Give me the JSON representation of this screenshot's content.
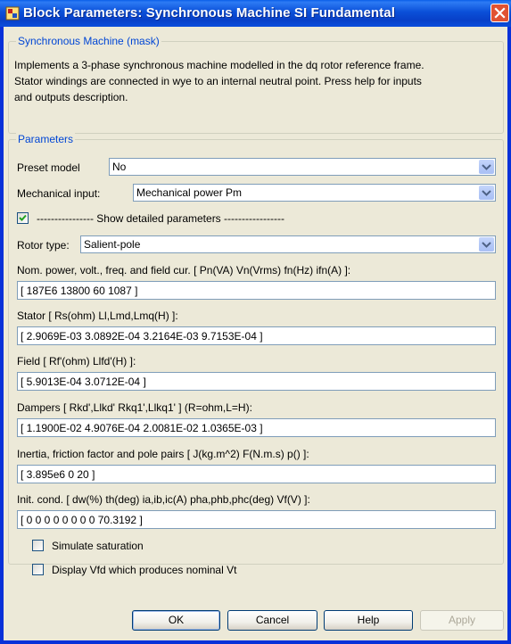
{
  "window": {
    "title": "Block Parameters: Synchronous Machine SI Fundamental",
    "close_label": "X"
  },
  "mask": {
    "group_title": "Synchronous Machine (mask)",
    "description_lines": [
      "Implements a 3-phase synchronous machine modelled in the dq rotor reference frame.",
      "Stator windings are connected in wye to an internal neutral point. Press help for inputs",
      "and outputs description."
    ]
  },
  "params": {
    "group_title": "Parameters",
    "preset_model": {
      "label": "Preset  model",
      "value": "No"
    },
    "mechanical_input": {
      "label": "Mechanical input:",
      "value": "Mechanical power Pm"
    },
    "show_detailed": {
      "label": "---------------- Show detailed parameters -----------------",
      "checked": true
    },
    "rotor_type": {
      "label": "Rotor type:",
      "value": "Salient-pole"
    },
    "fields": [
      {
        "label": "Nom. power, volt., freq. and field cur. [ Pn(VA) Vn(Vrms) fn(Hz) ifn(A) ]:",
        "value": "[ 187E6  13800   60   1087 ]"
      },
      {
        "label": "Stator [ Rs(ohm)  Ll,Lmd,Lmq(H) ]:",
        "value": "[ 2.9069E-03  3.0892E-04  3.2164E-03  9.7153E-04 ]"
      },
      {
        "label": "Field [ Rf'(ohm)  Llfd'(H) ]:",
        "value": "[ 5.9013E-04  3.0712E-04 ]"
      },
      {
        "label": "Dampers [ Rkd',Llkd'  Rkq1',Llkq1'  ] (R=ohm,L=H):",
        "value": "[ 1.1900E-02  4.9076E-04  2.0081E-02  1.0365E-03 ]"
      },
      {
        "label": "Inertia, friction factor and pole pairs [ J(kg.m^2)  F(N.m.s)  p() ]:",
        "value": "[ 3.895e6  0  20 ]"
      },
      {
        "label": "Init. cond. [ dw(%)  th(deg)  ia,ib,ic(A)  pha,phb,phc(deg)  Vf(V) ]:",
        "value": "[ 0  0  0  0  0  0  0  0  70.3192 ]"
      }
    ],
    "simulate_saturation": {
      "label": "Simulate saturation",
      "checked": false
    },
    "display_vfd": {
      "label": "Display Vfd which produces nominal Vt",
      "checked": false
    }
  },
  "buttons": {
    "ok": "OK",
    "cancel": "Cancel",
    "help": "Help",
    "apply": "Apply"
  },
  "colors": {
    "titlebar": "#0a4fd8",
    "face": "#ece9d8",
    "group_title": "#0046d5",
    "checkmark": "#21a121"
  }
}
